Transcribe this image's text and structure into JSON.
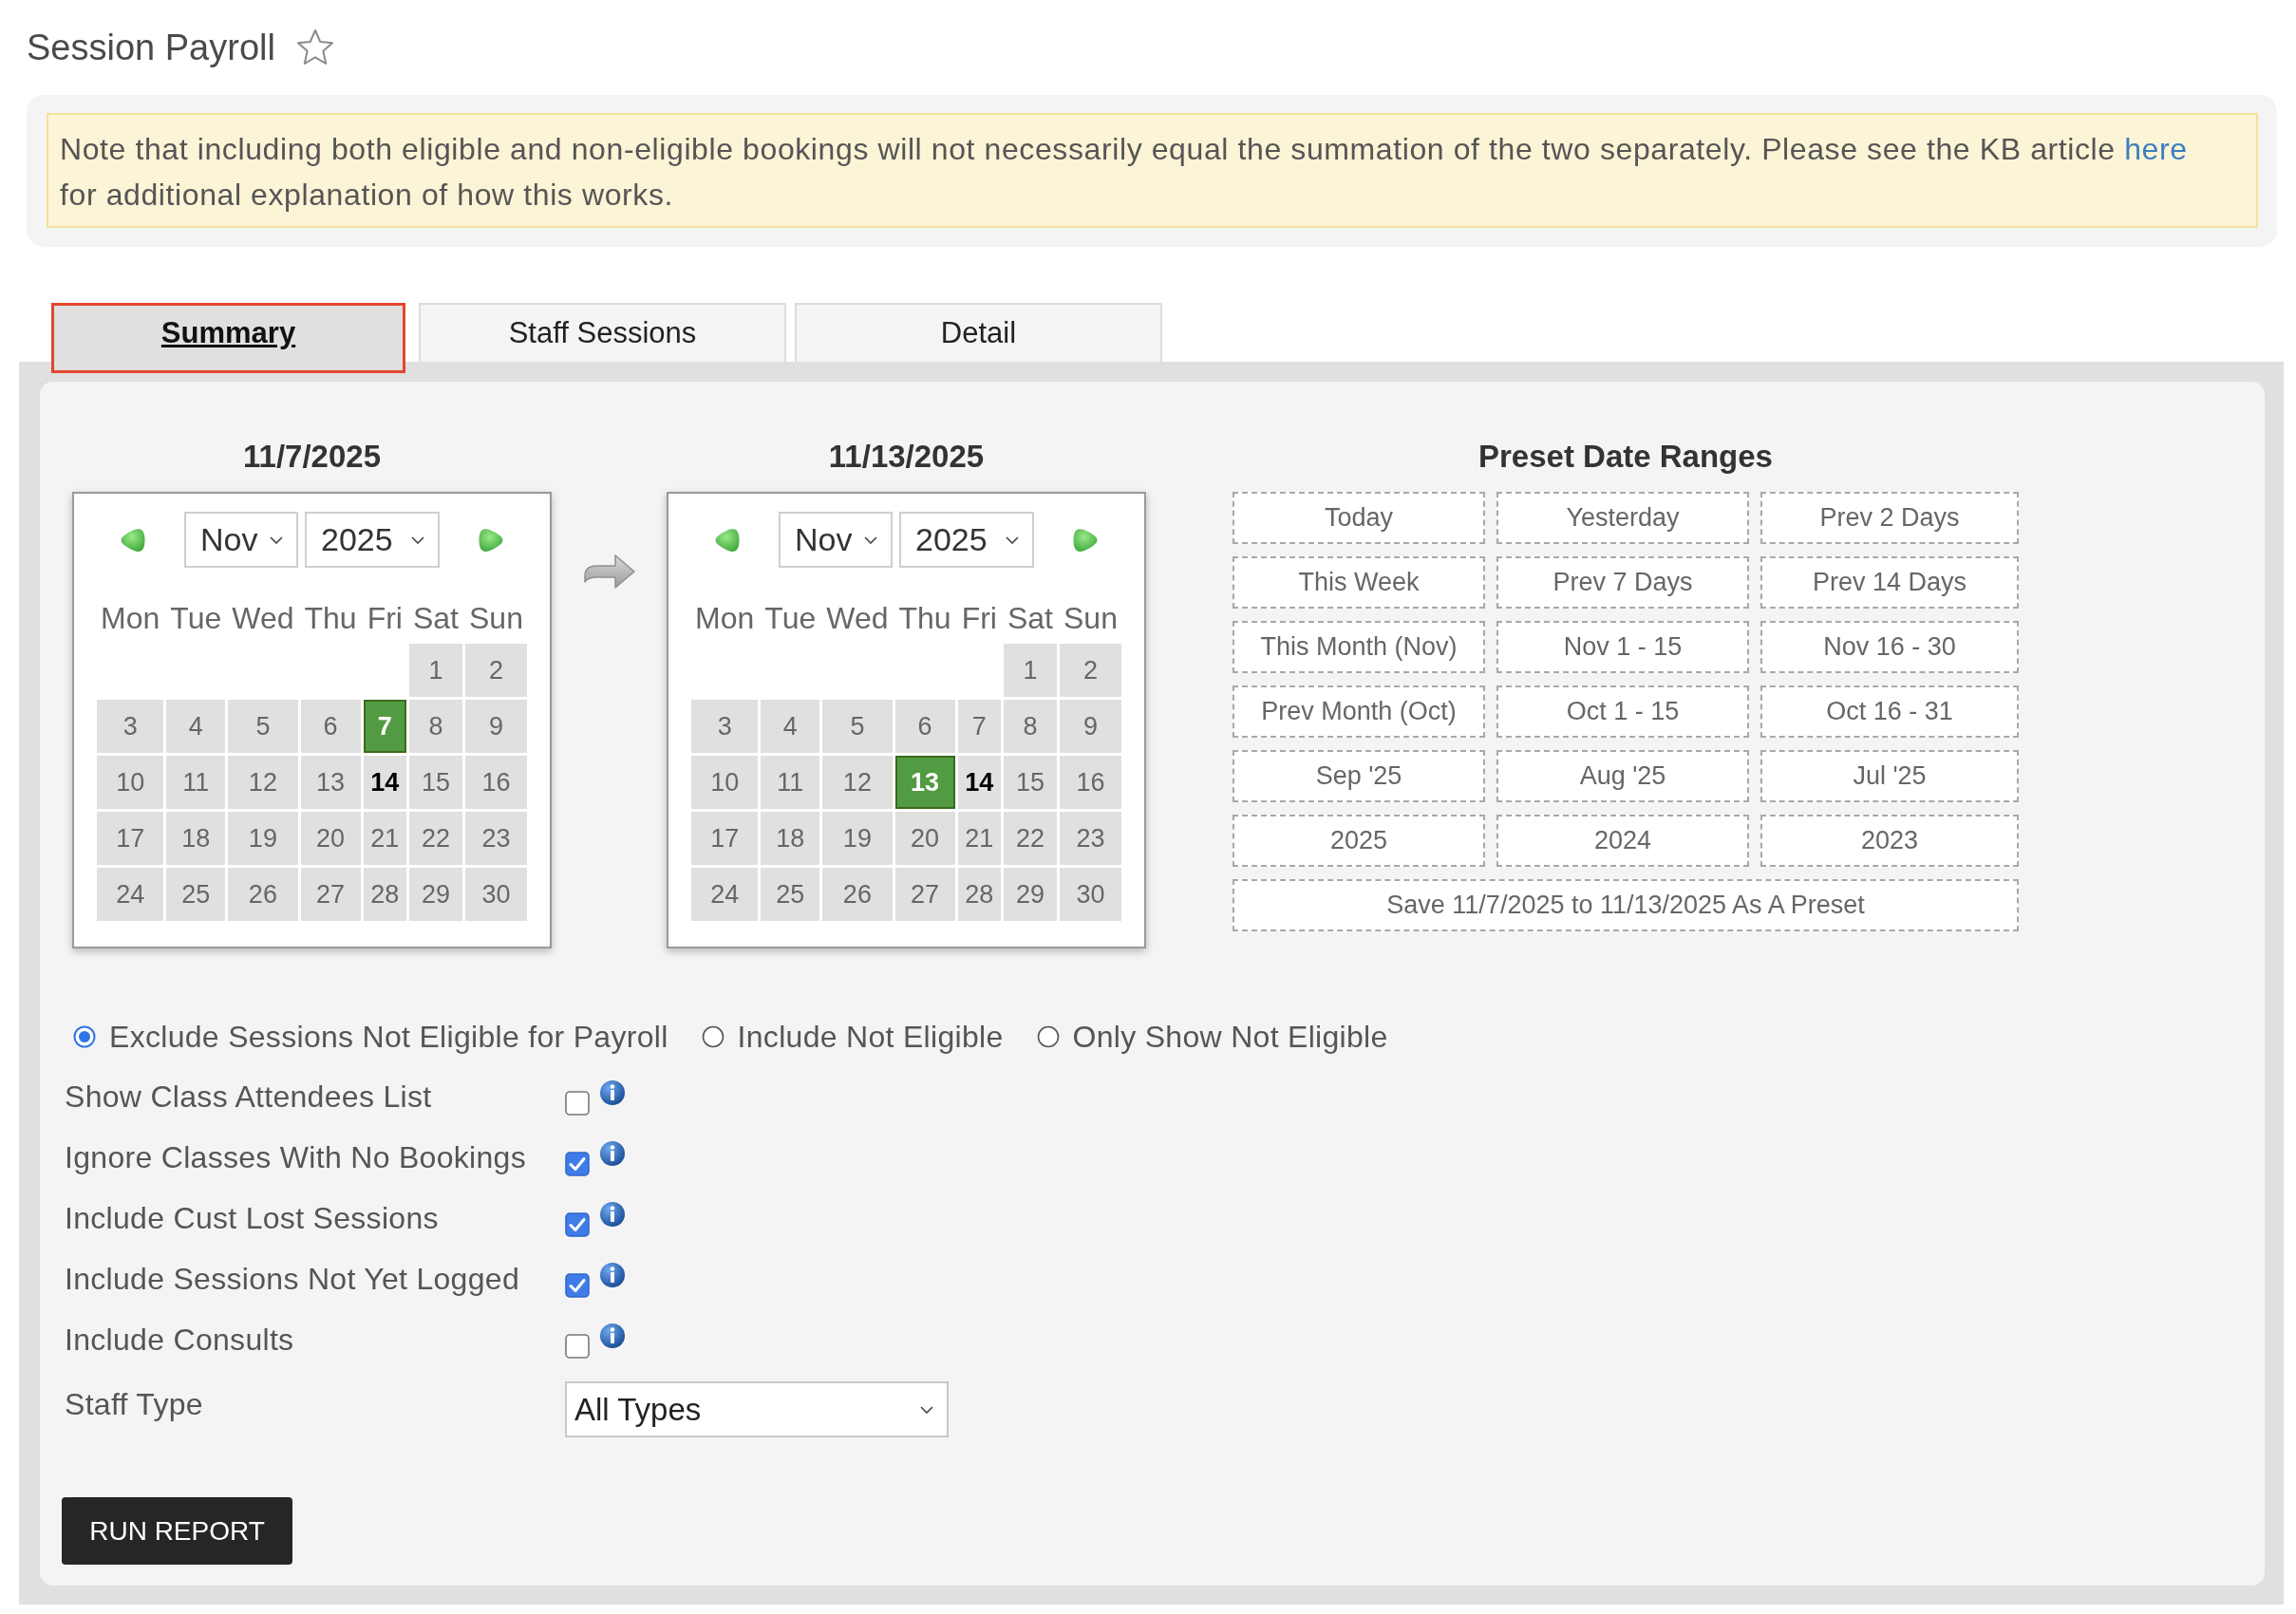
{
  "page": {
    "title": "Session Payroll",
    "starred": false
  },
  "notice": {
    "text_before": "Note that including both eligible and non-eligible bookings will not necessarily equal the summation of the two separately. Please see the KB article",
    "link": "here",
    "text_after": "for additional explanation of how this works."
  },
  "tabs": [
    {
      "label": "Summary",
      "selected": true
    },
    {
      "label": "Staff Sessions",
      "selected": false
    },
    {
      "label": "Detail",
      "selected": false
    }
  ],
  "calendars": [
    {
      "title": "11/7/2025",
      "month": "Nov",
      "year": "2025",
      "weekdays": [
        "Mon",
        "Tue",
        "Wed",
        "Thu",
        "Fri",
        "Sat",
        "Sun"
      ],
      "weeks": [
        [
          {
            "label": "1",
            "selected": false,
            "today": false
          },
          {
            "label": "2",
            "selected": false,
            "today": false
          }
        ],
        [
          {
            "label": "3",
            "selected": false,
            "today": false
          },
          {
            "label": "4",
            "selected": false,
            "today": false
          },
          {
            "label": "5",
            "selected": false,
            "today": false
          },
          {
            "label": "6",
            "selected": false,
            "today": false
          },
          {
            "label": "7",
            "selected": true,
            "today": false
          },
          {
            "label": "8",
            "selected": false,
            "today": false
          },
          {
            "label": "9",
            "selected": false,
            "today": false
          }
        ],
        [
          {
            "label": "10",
            "selected": false,
            "today": false
          },
          {
            "label": "11",
            "selected": false,
            "today": false
          },
          {
            "label": "12",
            "selected": false,
            "today": false
          },
          {
            "label": "13",
            "selected": false,
            "today": false
          },
          {
            "label": "14",
            "selected": false,
            "today": true
          },
          {
            "label": "15",
            "selected": false,
            "today": false
          },
          {
            "label": "16",
            "selected": false,
            "today": false
          }
        ],
        [
          {
            "label": "17",
            "selected": false,
            "today": false
          },
          {
            "label": "18",
            "selected": false,
            "today": false
          },
          {
            "label": "19",
            "selected": false,
            "today": false
          },
          {
            "label": "20",
            "selected": false,
            "today": false
          },
          {
            "label": "21",
            "selected": false,
            "today": false
          },
          {
            "label": "22",
            "selected": false,
            "today": false
          },
          {
            "label": "23",
            "selected": false,
            "today": false
          }
        ],
        [
          {
            "label": "24",
            "selected": false,
            "today": false
          },
          {
            "label": "25",
            "selected": false,
            "today": false
          },
          {
            "label": "26",
            "selected": false,
            "today": false
          },
          {
            "label": "27",
            "selected": false,
            "today": false
          },
          {
            "label": "28",
            "selected": false,
            "today": false
          },
          {
            "label": "29",
            "selected": false,
            "today": false
          },
          {
            "label": "30",
            "selected": false,
            "today": false
          }
        ]
      ]
    },
    {
      "title": "11/13/2025",
      "month": "Nov",
      "year": "2025",
      "weekdays": [
        "Mon",
        "Tue",
        "Wed",
        "Thu",
        "Fri",
        "Sat",
        "Sun"
      ],
      "weeks": [
        [
          {
            "label": "1",
            "selected": false,
            "today": false
          },
          {
            "label": "2",
            "selected": false,
            "today": false
          }
        ],
        [
          {
            "label": "3",
            "selected": false,
            "today": false
          },
          {
            "label": "4",
            "selected": false,
            "today": false
          },
          {
            "label": "5",
            "selected": false,
            "today": false
          },
          {
            "label": "6",
            "selected": false,
            "today": false
          },
          {
            "label": "7",
            "selected": false,
            "today": false
          },
          {
            "label": "8",
            "selected": false,
            "today": false
          },
          {
            "label": "9",
            "selected": false,
            "today": false
          }
        ],
        [
          {
            "label": "10",
            "selected": false,
            "today": false
          },
          {
            "label": "11",
            "selected": false,
            "today": false
          },
          {
            "label": "12",
            "selected": false,
            "today": false
          },
          {
            "label": "13",
            "selected": true,
            "today": false
          },
          {
            "label": "14",
            "selected": false,
            "today": true
          },
          {
            "label": "15",
            "selected": false,
            "today": false
          },
          {
            "label": "16",
            "selected": false,
            "today": false
          }
        ],
        [
          {
            "label": "17",
            "selected": false,
            "today": false
          },
          {
            "label": "18",
            "selected": false,
            "today": false
          },
          {
            "label": "19",
            "selected": false,
            "today": false
          },
          {
            "label": "20",
            "selected": false,
            "today": false
          },
          {
            "label": "21",
            "selected": false,
            "today": false
          },
          {
            "label": "22",
            "selected": false,
            "today": false
          },
          {
            "label": "23",
            "selected": false,
            "today": false
          }
        ],
        [
          {
            "label": "24",
            "selected": false,
            "today": false
          },
          {
            "label": "25",
            "selected": false,
            "today": false
          },
          {
            "label": "26",
            "selected": false,
            "today": false
          },
          {
            "label": "27",
            "selected": false,
            "today": false
          },
          {
            "label": "28",
            "selected": false,
            "today": false
          },
          {
            "label": "29",
            "selected": false,
            "today": false
          },
          {
            "label": "30",
            "selected": false,
            "today": false
          }
        ]
      ]
    }
  ],
  "preset_date_ranges": {
    "title": "Preset Date Ranges",
    "presets": [
      "Today",
      "Yesterday",
      "Prev 2 Days",
      "This Week",
      "Prev 7 Days",
      "Prev 14 Days",
      "This Month (Nov)",
      "Nov 1 - 15",
      "Nov 16 - 30",
      "Prev Month (Oct)",
      "Oct 1 - 15",
      "Oct 16 - 31",
      "Sep '25",
      "Aug '25",
      "Jul '25",
      "2025",
      "2024",
      "2023"
    ],
    "save_preset": "Save 11/7/2025 to 11/13/2025 As A Preset"
  },
  "eligibility": [
    {
      "label": "Exclude Sessions Not Eligible for Payroll",
      "selected": true
    },
    {
      "label": "Include Not Eligible",
      "selected": false
    },
    {
      "label": "Only Show Not Eligible",
      "selected": false
    }
  ],
  "options": [
    {
      "label": "Show Class Attendees List",
      "checked": false
    },
    {
      "label": "Ignore Classes With No Bookings",
      "checked": true
    },
    {
      "label": "Include Cust Lost Sessions",
      "checked": true
    },
    {
      "label": "Include Sessions Not Yet Logged",
      "checked": true
    },
    {
      "label": "Include Consults",
      "checked": false
    }
  ],
  "staff_type": {
    "label": "Staff Type",
    "value": "All Types"
  },
  "run_report": "RUN REPORT"
}
